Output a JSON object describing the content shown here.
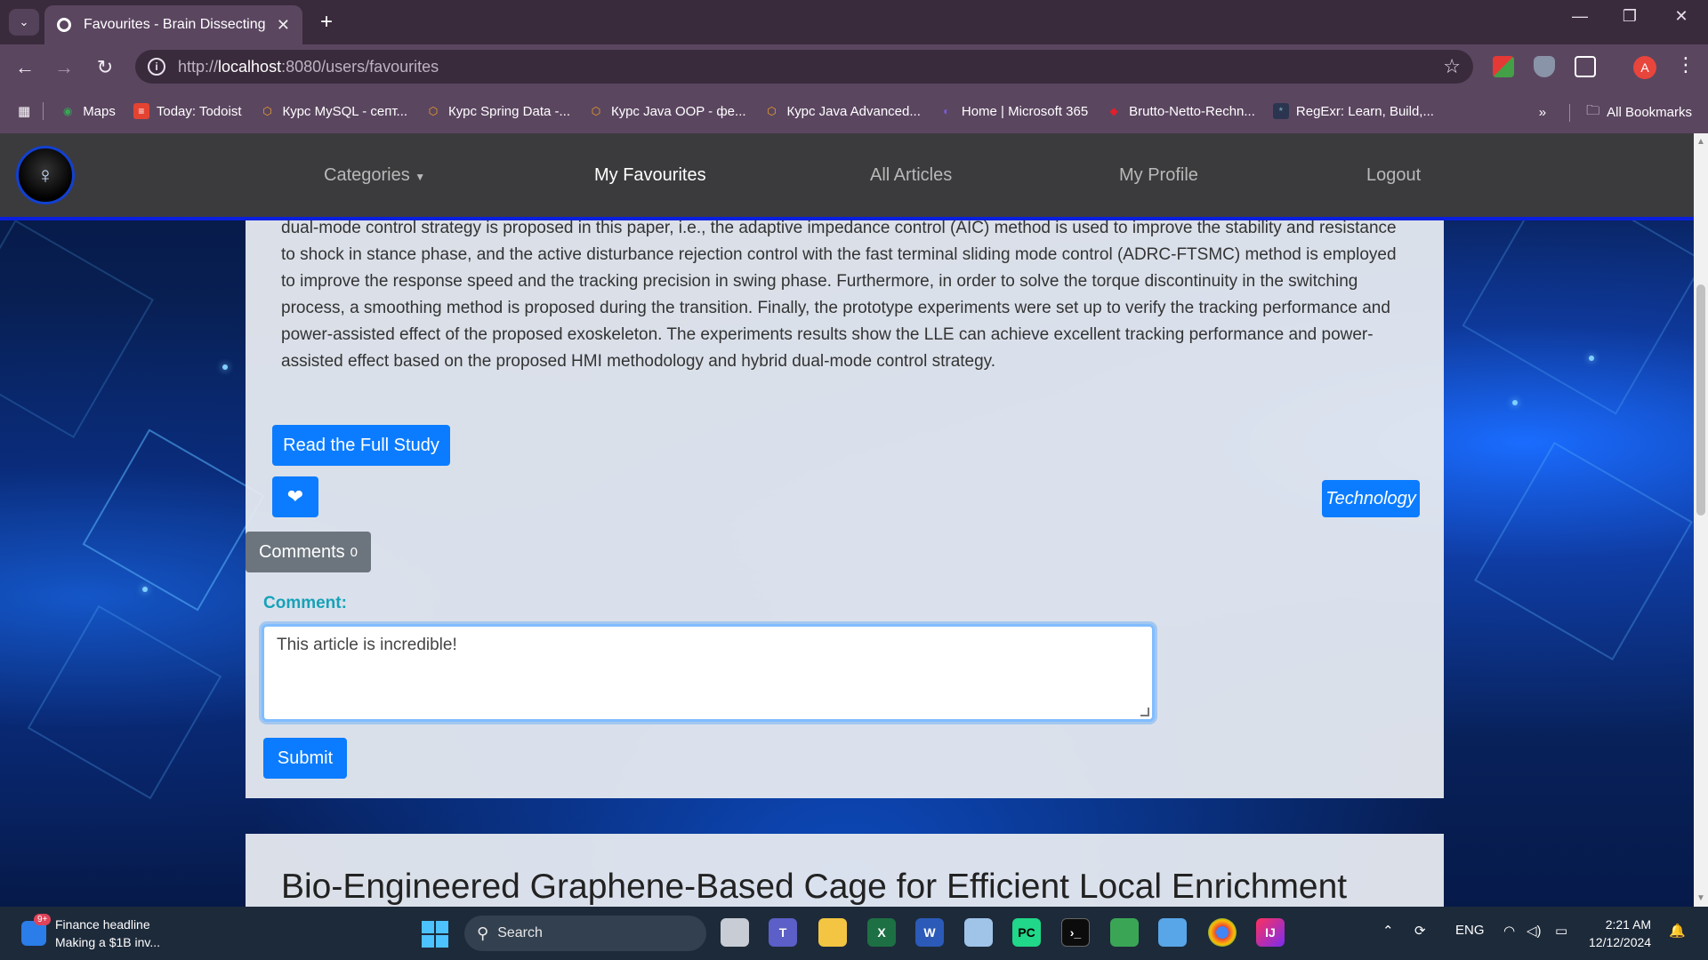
{
  "browser": {
    "tab_title": "Favourites - Brain Dissecting",
    "url_scheme": "http://",
    "url_host": "localhost",
    "url_path": ":8080/users/favourites",
    "bookmarks": [
      {
        "label": "Maps",
        "icon": "maps-icon",
        "color": "#34a853"
      },
      {
        "label": "Today: Todoist",
        "icon": "todoist-icon",
        "color": "#e44332"
      },
      {
        "label": "Курс MySQL - септ...",
        "icon": "course-icon",
        "color": "#f5a623"
      },
      {
        "label": "Курс Spring Data -...",
        "icon": "course-icon",
        "color": "#f5a623"
      },
      {
        "label": "Курс Java OOP - фе...",
        "icon": "course-icon",
        "color": "#f5a623"
      },
      {
        "label": "Курс Java Advanced...",
        "icon": "course-icon",
        "color": "#f5a623"
      },
      {
        "label": "Home | Microsoft 365",
        "icon": "microsoft365-icon",
        "color": "#7b5ce6"
      },
      {
        "label": "Brutto-Netto-Rechn...",
        "icon": "calculator-icon",
        "color": "#e0202a"
      },
      {
        "label": "RegExr: Learn, Build,...",
        "icon": "regexr-icon",
        "color": "#2a6fdb"
      }
    ],
    "all_bookmarks": "All Bookmarks",
    "profile_initial": "A"
  },
  "site": {
    "nav": {
      "categories": "Categories",
      "favourites": "My Favourites",
      "articles": "All Articles",
      "profile": "My Profile",
      "logout": "Logout"
    },
    "article": {
      "abstract": "dual-mode control strategy is proposed in this paper, i.e., the adaptive impedance control (AIC) method is used to improve the stability and resistance to shock in stance phase, and the active disturbance rejection control with the fast terminal sliding mode control (ADRC-FTSMC) method is employed to improve the response speed and the tracking precision in swing phase. Furthermore, in order to solve the torque discontinuity in the switching process, a smoothing method is proposed during the transition. Finally, the prototype experiments were set up to verify the tracking performance and power-assisted effect of the proposed exoskeleton. The experiments results show the LLE can achieve excellent tracking performance and power-assisted effect based on the proposed HMI methodology and hybrid dual-mode control strategy.",
      "read_button": "Read the Full Study",
      "category_tag": "Technology",
      "comments_label": "Comments",
      "comments_count": "0",
      "comment_field_label": "Comment:",
      "comment_value": "This article is incredible!",
      "submit": "Submit"
    },
    "next_article_title": "Bio-Engineered Graphene-Based Cage for Efficient Local Enrichment"
  },
  "taskbar": {
    "news_title": "Finance headline",
    "news_sub": "Making a $1B inv...",
    "news_badge": "9+",
    "search_label": "Search",
    "language": "ENG",
    "time": "2:21 AM",
    "date": "12/12/2024"
  },
  "colors": {
    "accent": "#0b7cff",
    "comment_label": "#17a2b8",
    "nav_bg": "#3b3b3d"
  }
}
